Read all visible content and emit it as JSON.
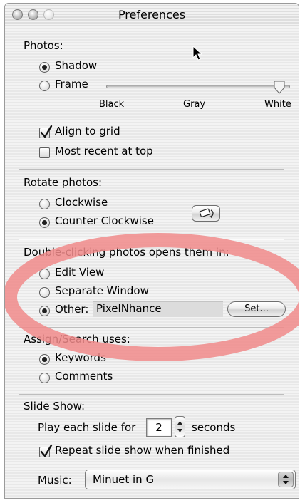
{
  "window": {
    "title": "Preferences"
  },
  "photos": {
    "heading": "Photos:",
    "shadow_label": "Shadow",
    "frame_label": "Frame",
    "selected": "Shadow",
    "slider_labels": [
      "Black",
      "Gray",
      "White"
    ],
    "slider_value": "White",
    "align_label": "Align to grid",
    "align_checked": true,
    "recent_label": "Most recent at top",
    "recent_checked": false
  },
  "rotate": {
    "heading": "Rotate photos:",
    "clockwise_label": "Clockwise",
    "counter_label": "Counter Clockwise",
    "selected": "Counter Clockwise",
    "icon": "rotate-icon"
  },
  "doubleclick": {
    "heading": "Double-clicking photos opens them in:",
    "edit_label": "Edit View",
    "separate_label": "Separate Window",
    "other_label": "Other:",
    "selected": "Other:",
    "other_value": "PixelNhance",
    "set_label": "Set..."
  },
  "assign": {
    "heading": "Assign/Search uses:",
    "keywords_label": "Keywords",
    "comments_label": "Comments",
    "selected": "Keywords"
  },
  "slideshow": {
    "heading": "Slide Show:",
    "play_prefix": "Play each slide for",
    "seconds_value": "2",
    "play_suffix": "seconds",
    "repeat_label": "Repeat slide show when finished",
    "repeat_checked": true,
    "music_label": "Music:",
    "music_value": "Minuet in G"
  },
  "annotation": {
    "ellipse_color": "#f08a8a"
  }
}
